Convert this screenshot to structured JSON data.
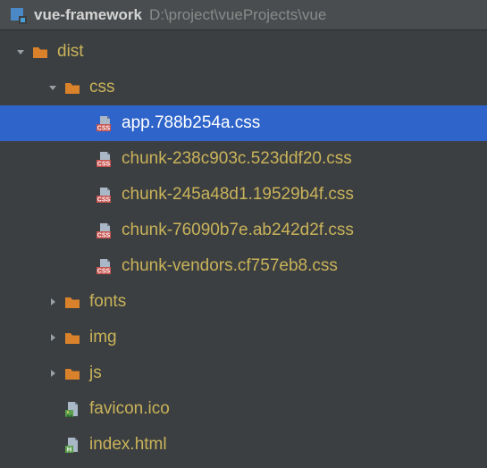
{
  "header": {
    "project_name": "vue-framework",
    "project_path": "D:\\project\\vueProjects\\vue"
  },
  "icons": {
    "folder_color": "#d9822b",
    "css_badge_color": "#c75450",
    "css_badge_text": "CSS",
    "html_badge_color": "#5b9e4d",
    "html_badge_text": "H",
    "img_badge_color": "#5b9e4d"
  },
  "tree": [
    {
      "id": "dist",
      "label": "dist",
      "depth": 0,
      "kind": "folder",
      "expanded": true,
      "selected": false
    },
    {
      "id": "css",
      "label": "css",
      "depth": 1,
      "kind": "folder",
      "expanded": true,
      "selected": false
    },
    {
      "id": "app-css",
      "label": "app.788b254a.css",
      "depth": 2,
      "kind": "css",
      "selected": true
    },
    {
      "id": "chunk-238",
      "label": "chunk-238c903c.523ddf20.css",
      "depth": 2,
      "kind": "css",
      "selected": false
    },
    {
      "id": "chunk-245",
      "label": "chunk-245a48d1.19529b4f.css",
      "depth": 2,
      "kind": "css",
      "selected": false
    },
    {
      "id": "chunk-760",
      "label": "chunk-76090b7e.ab242d2f.css",
      "depth": 2,
      "kind": "css",
      "selected": false
    },
    {
      "id": "chunk-vend",
      "label": "chunk-vendors.cf757eb8.css",
      "depth": 2,
      "kind": "css",
      "selected": false
    },
    {
      "id": "fonts",
      "label": "fonts",
      "depth": 1,
      "kind": "folder",
      "expanded": false,
      "selected": false
    },
    {
      "id": "img",
      "label": "img",
      "depth": 1,
      "kind": "folder",
      "expanded": false,
      "selected": false
    },
    {
      "id": "js",
      "label": "js",
      "depth": 1,
      "kind": "folder",
      "expanded": false,
      "selected": false
    },
    {
      "id": "favicon",
      "label": "favicon.ico",
      "depth": 1,
      "kind": "image",
      "selected": false
    },
    {
      "id": "index",
      "label": "index.html",
      "depth": 1,
      "kind": "html",
      "selected": false
    }
  ]
}
